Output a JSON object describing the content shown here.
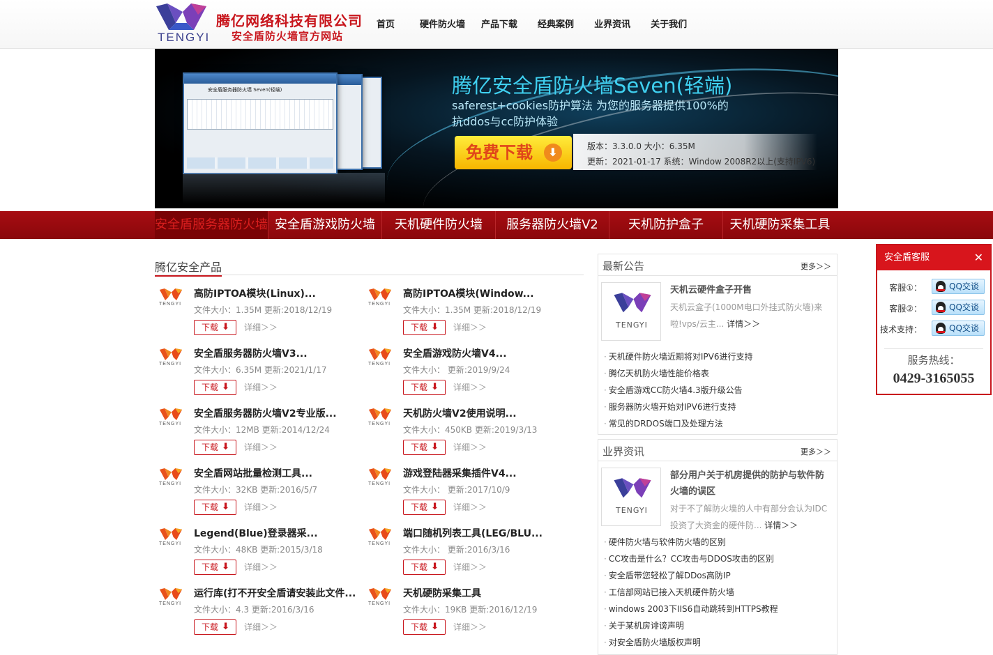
{
  "header": {
    "logo_text": "TENGYI",
    "company_name": "腾亿网络科技有限公司",
    "company_sub": "安全盾防火墙官方网站",
    "nav": [
      "首页",
      "硬件防火墙",
      "产品下载",
      "经典案例",
      "业界资讯",
      "关于我们"
    ]
  },
  "banner": {
    "title": "腾亿安全盾防火墙Seven(轻端)",
    "subtitle_line1": "saferest+cookies防护算法 为您的服务器提供100%的",
    "subtitle_line2": "抗ddos与cc防护体验",
    "download_label": "免费下载",
    "version_line": "版本：3.3.0.0    大小：6.35M",
    "update_line": "更新：2021-01-17    系统：Window 2008R2以上(支持IPV6)",
    "screenshot_caption": "安全盾服务器防火墙 Seven(轻端)"
  },
  "tabs": [
    "安全盾服务器防火墙",
    "安全盾游戏防火墙",
    "天机硬件防火墙",
    "服务器防火墙V2",
    "天机防护盒子",
    "天机硬防采集工具"
  ],
  "products": {
    "section_title": "腾亿安全产品",
    "download_label": "下载",
    "detail_label": "详细＞＞",
    "logo_text": "TENGYI",
    "items": [
      {
        "name": "高防IPTOA模块(Linux)...",
        "meta": "文件大小：1.35M   更新:2018/12/19"
      },
      {
        "name": "高防IPTOA模块(Window...",
        "meta": "文件大小：1.35M   更新:2018/12/19"
      },
      {
        "name": "安全盾服务器防火墙V3...",
        "meta": "文件大小：6.35M   更新:2021/1/17"
      },
      {
        "name": "安全盾游戏防火墙V4...",
        "meta": "文件大小：     更新:2019/9/24"
      },
      {
        "name": "安全盾服务器防火墙V2专业版...",
        "meta": "文件大小：12MB   更新:2014/12/24"
      },
      {
        "name": "天机防火墙V2使用说明...",
        "meta": "文件大小：450KB   更新:2019/3/13"
      },
      {
        "name": "安全盾网站批量检测工具...",
        "meta": "文件大小：32KB   更新:2016/5/7"
      },
      {
        "name": "游戏登陆器采集插件V4...",
        "meta": "文件大小：     更新:2017/10/9"
      },
      {
        "name": "Legend(Blue)登录器采...",
        "meta": "文件大小：48KB   更新:2015/3/18"
      },
      {
        "name": "端口随机列表工具(LEG/BLU...",
        "meta": "文件大小：     更新:2016/3/16"
      },
      {
        "name": "运行库(打不开安全盾请安装此文件...",
        "meta": "文件大小：4.3   更新:2016/3/16"
      },
      {
        "name": "天机硬防采集工具",
        "meta": "文件大小：19KB   更新:2016/12/19"
      }
    ]
  },
  "notices": {
    "title": "最新公告",
    "more": "更多＞＞",
    "thumb_text": "TENGYI",
    "feature_title": "天机云硬件盒子开售",
    "feature_desc": "天机云盒子(1000M电口外挂式防火墙)来啦!vps/云主...",
    "feature_more": "详情＞＞",
    "items": [
      "天机硬件防火墙近期将对IPV6进行支持",
      "腾亿天机防火墙性能价格表",
      "安全盾游戏CC防火墙4.3版升级公告",
      "服务器防火墙开始对IPV6进行支持",
      "常见的DRDOS端口及处理方法"
    ]
  },
  "news": {
    "title": "业界资讯",
    "more": "更多＞＞",
    "thumb_text": "TENGYI",
    "feature_title": "部分用户关于机房提供的防护与软件防火墙的误区",
    "feature_desc": "对于不了解防火墙的人中有部分会认为IDC投资了大资金的硬件防...",
    "feature_more": "详情＞＞",
    "items": [
      "硬件防火墙与软件防火墙的区别",
      "CC攻击是什么？CC攻击与DDOS攻击的区别",
      "安全盾带您轻松了解DDos高防IP",
      "工信部网站已接入天机硬件防火墙",
      "windows 2003下IIS6自动跳转到HTTPS教程",
      "关于某机房诽谤声明",
      "对安全盾防火墙版权声明"
    ]
  },
  "service": {
    "title": "安全盾客服",
    "close": "✕",
    "rows": [
      {
        "label": "客服①：",
        "button": "QQ交谈"
      },
      {
        "label": "客服②：",
        "button": "QQ交谈"
      },
      {
        "label": "技术支持：",
        "button": "QQ交谈"
      }
    ],
    "hotline_label": "服务热线：",
    "hotline": "0429-3165055"
  },
  "colors": {
    "brand_red": "#c8161d",
    "tab_bar": "#a70d12",
    "banner_accent": "#3fd0f0",
    "download_yellow": "#f7b500"
  }
}
